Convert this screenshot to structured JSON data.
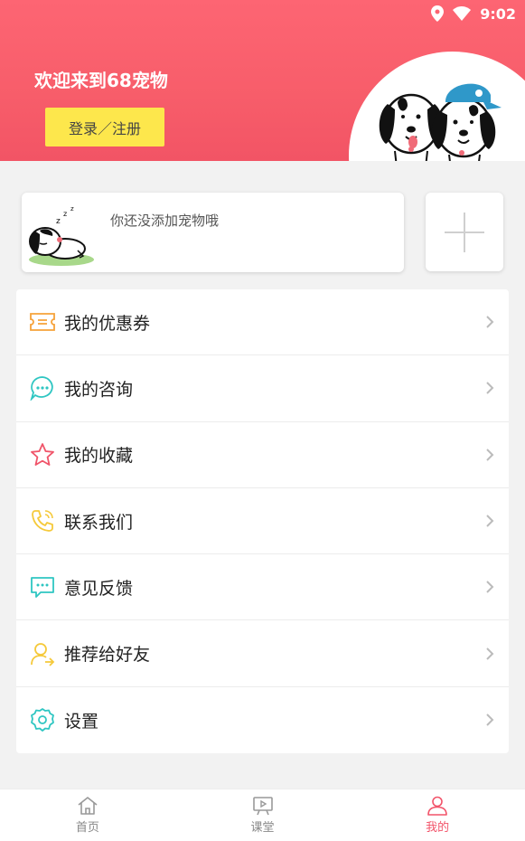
{
  "status_bar": {
    "time": "9:02"
  },
  "header": {
    "welcome": "欢迎来到68宠物",
    "login_label": "登录／注册"
  },
  "pet_card": {
    "empty_text": "你还没添加宠物哦"
  },
  "menu": {
    "items": [
      {
        "label": "我的优惠券",
        "icon": "coupon-icon",
        "color": "#f6a23a"
      },
      {
        "label": "我的咨询",
        "icon": "chat-bubble-icon",
        "color": "#2fc6c2"
      },
      {
        "label": "我的收藏",
        "icon": "star-icon",
        "color": "#f0556a"
      },
      {
        "label": "联系我们",
        "icon": "phone-icon",
        "color": "#f5c93a"
      },
      {
        "label": "意见反馈",
        "icon": "feedback-icon",
        "color": "#2fc6c2"
      },
      {
        "label": "推荐给好友",
        "icon": "user-share-icon",
        "color": "#f5c93a"
      },
      {
        "label": "设置",
        "icon": "settings-icon",
        "color": "#2fc6c2"
      }
    ]
  },
  "tabbar": {
    "tabs": [
      {
        "label": "首页",
        "icon": "home-icon"
      },
      {
        "label": "课堂",
        "icon": "video-board-icon"
      },
      {
        "label": "我的",
        "icon": "user-icon",
        "active": true
      }
    ]
  },
  "colors": {
    "brand": "#f75d6a",
    "login_button": "#fde74c",
    "active_tab": "#f2546a"
  }
}
